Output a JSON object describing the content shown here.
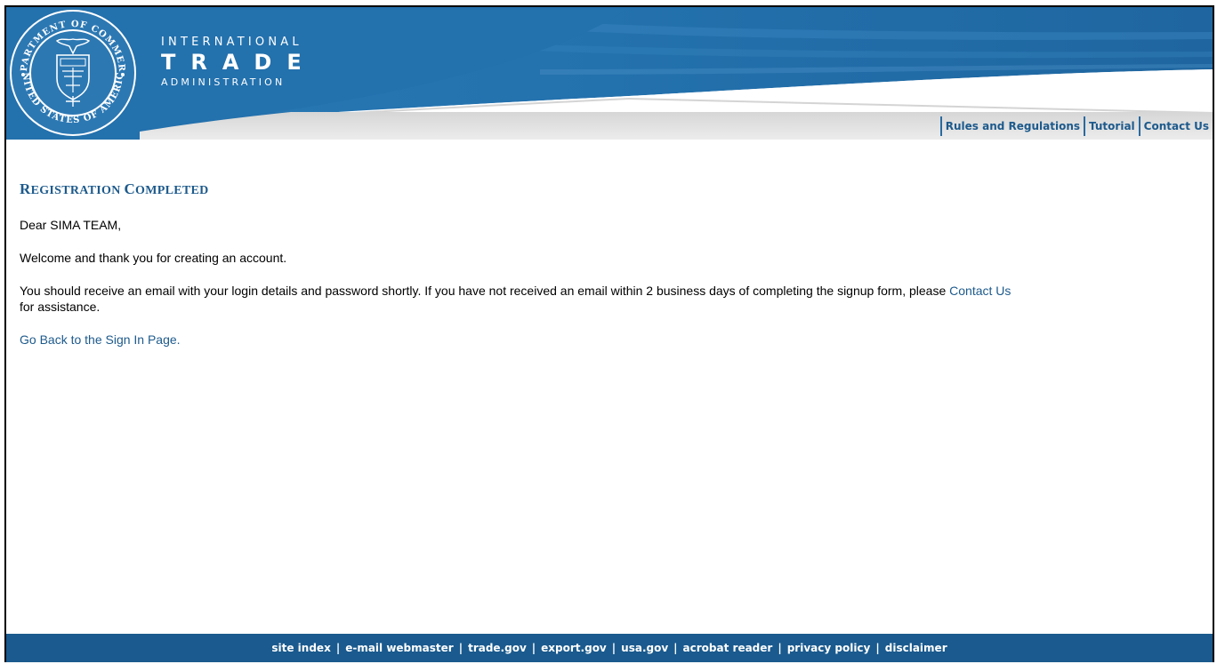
{
  "header": {
    "seal_text_top": "DEPARTMENT OF COMMERCE",
    "seal_text_bottom": "UNITED STATES OF AMERICA",
    "brand_line1": "INTERNATIONAL",
    "brand_line2": "TRADE",
    "brand_line3": "ADMINISTRATION",
    "nav": [
      {
        "label": "Rules and Regulations"
      },
      {
        "label": "Tutorial"
      },
      {
        "label": "Contact Us"
      }
    ]
  },
  "content": {
    "title_first": "R",
    "title_rest_1": "EGISTRATION ",
    "title_second": "C",
    "title_rest_2": "OMPLETED",
    "greeting": "Dear SIMA TEAM,",
    "welcome": "Welcome and thank you for creating an account.",
    "info_before": "You should receive an email with your login details and password shortly. If you have not received an email within 2 business days of completing the signup form, please ",
    "info_link": "Contact Us",
    "info_after": " for assistance.",
    "back_link": "Go Back to the Sign In Page",
    "back_after": "."
  },
  "footer": {
    "links": [
      {
        "label": "site index"
      },
      {
        "label": "e-mail webmaster"
      },
      {
        "label": "trade.gov"
      },
      {
        "label": "export.gov"
      },
      {
        "label": "usa.gov"
      },
      {
        "label": "acrobat reader"
      },
      {
        "label": "privacy policy"
      },
      {
        "label": "disclaimer"
      }
    ]
  },
  "colors": {
    "header_blue": "#1f6aa3",
    "link_blue": "#1d5a8c",
    "footer_blue": "#1a5a8e"
  }
}
